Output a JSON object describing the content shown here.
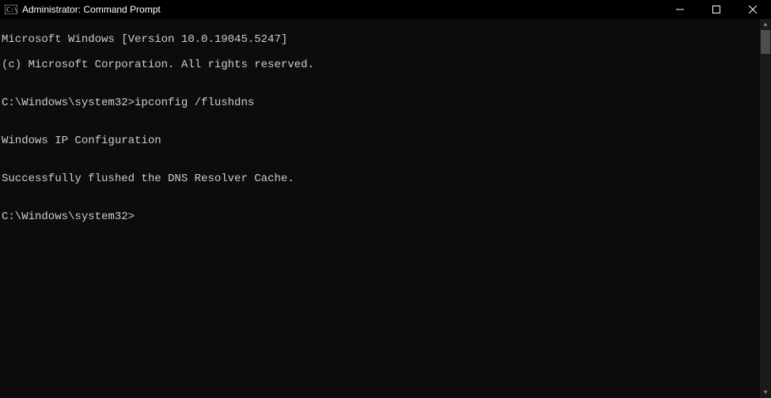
{
  "window": {
    "title": "Administrator: Command Prompt"
  },
  "terminal": {
    "lines": {
      "l0": "Microsoft Windows [Version 10.0.19045.5247]",
      "l1": "(c) Microsoft Corporation. All rights reserved.",
      "l2": "",
      "l3": "C:\\Windows\\system32>ipconfig /flushdns",
      "l4": "",
      "l5": "Windows IP Configuration",
      "l6": "",
      "l7": "Successfully flushed the DNS Resolver Cache.",
      "l8": "",
      "l9": "C:\\Windows\\system32>"
    }
  }
}
